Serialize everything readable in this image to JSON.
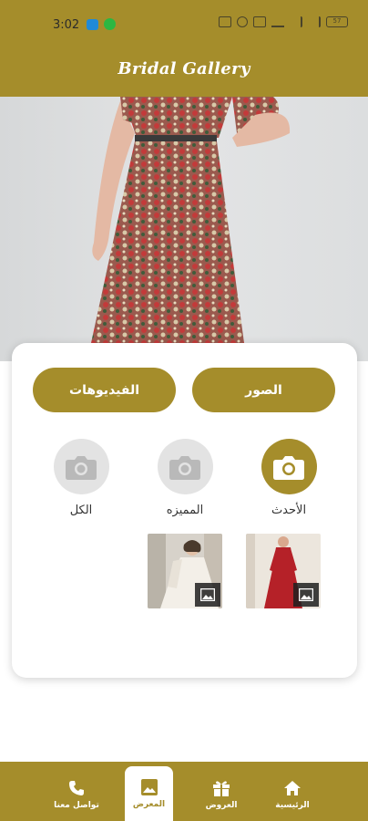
{
  "status": {
    "time": "3:02",
    "battery": "57"
  },
  "header": {
    "title": "Bridal Gallery"
  },
  "tabs": {
    "photos": "الصور",
    "videos": "الفيديوهات"
  },
  "filters": [
    {
      "label": "الأحدث",
      "active": true,
      "icon": "camera-icon"
    },
    {
      "label": "المميزه",
      "active": false,
      "icon": "camera-icon"
    },
    {
      "label": "الكل",
      "active": false,
      "icon": "camera-icon"
    }
  ],
  "nav": [
    {
      "label": "الرئيسية",
      "icon": "home-icon"
    },
    {
      "label": "العروض",
      "icon": "gift-icon"
    },
    {
      "label": "المعرض",
      "icon": "gallery-icon",
      "active": true
    },
    {
      "label": "تواصل معنا",
      "icon": "phone-icon"
    }
  ],
  "colors": {
    "accent": "#a58d2b",
    "inactive": "#e3e3e3",
    "background": "#ffffff"
  }
}
